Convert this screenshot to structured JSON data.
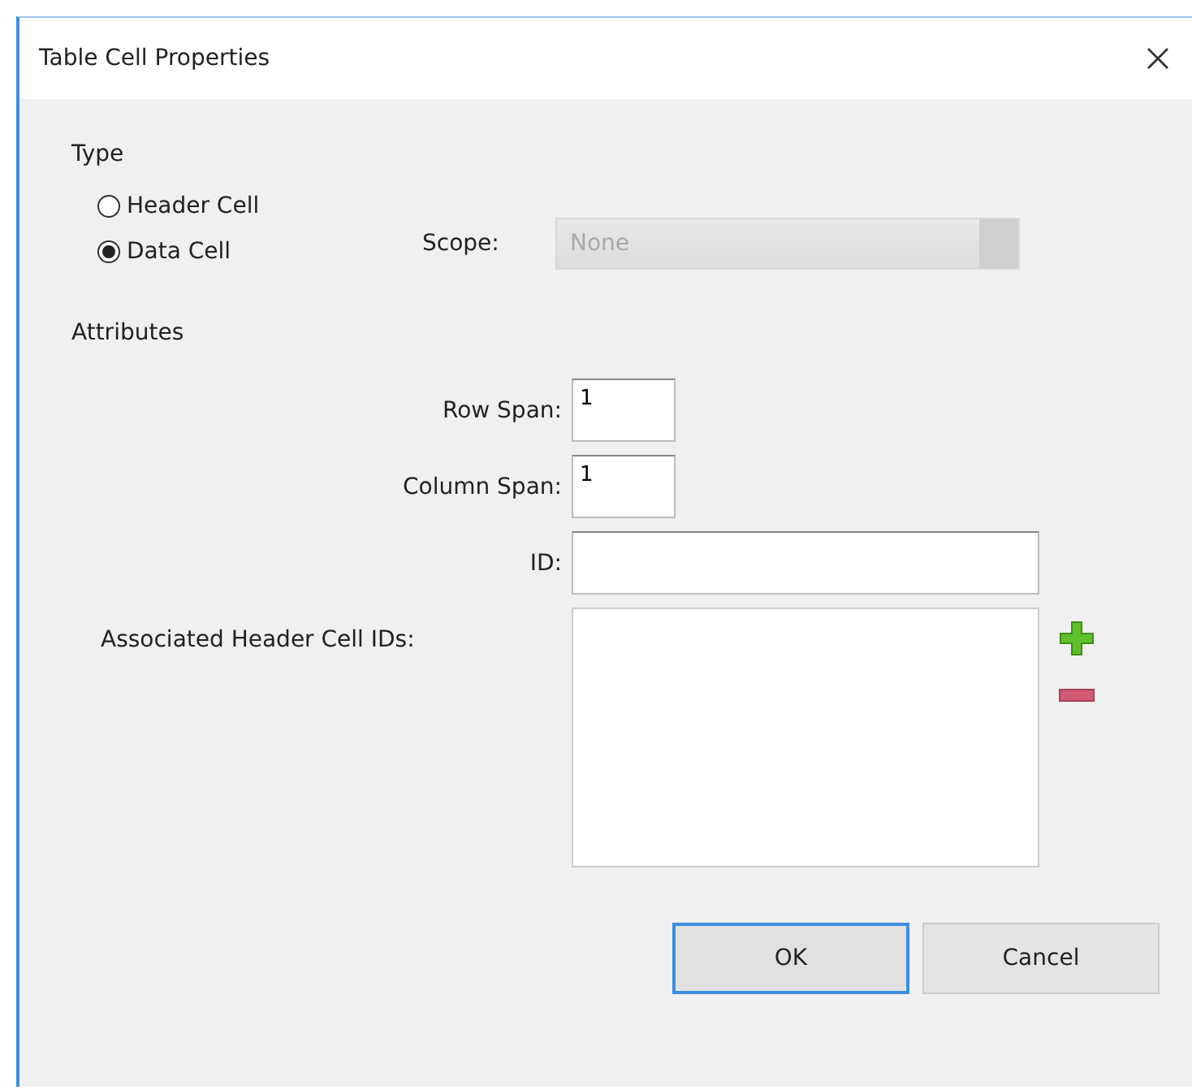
{
  "window": {
    "title": "Table Cell Properties"
  },
  "type_group": {
    "label": "Type",
    "radios": [
      {
        "label": "Header Cell",
        "selected": false
      },
      {
        "label": "Data Cell",
        "selected": true
      }
    ],
    "scope": {
      "label": "Scope:",
      "value": "None",
      "disabled": true
    }
  },
  "attributes": {
    "label": "Attributes",
    "fields": [
      {
        "label": "Row Span:",
        "value": "1",
        "kind": "short"
      },
      {
        "label": "Column Span:",
        "value": "1",
        "kind": "short"
      },
      {
        "label": "ID:",
        "kind": "wide"
      }
    ],
    "header_ids": {
      "label": "Associated Header Cell IDs:"
    }
  },
  "buttons": [
    {
      "label": "OK",
      "default": true
    },
    {
      "label": "Cancel",
      "default": false
    }
  ]
}
